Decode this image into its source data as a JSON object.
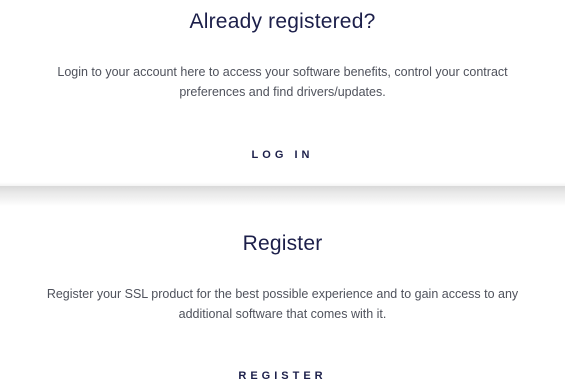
{
  "login_section": {
    "heading": "Already registered?",
    "description": "Login to your account here to access your software benefits, control your contract preferences and find drivers/updates.",
    "button_label": "LOG IN"
  },
  "register_section": {
    "heading": "Register",
    "description": "Register your SSL product for the best possible experience and to gain access to any additional software that comes with it.",
    "button_label": "REGISTER"
  },
  "colors": {
    "heading": "#1c1f4a",
    "body_text": "#4f525c",
    "background": "#ffffff"
  }
}
